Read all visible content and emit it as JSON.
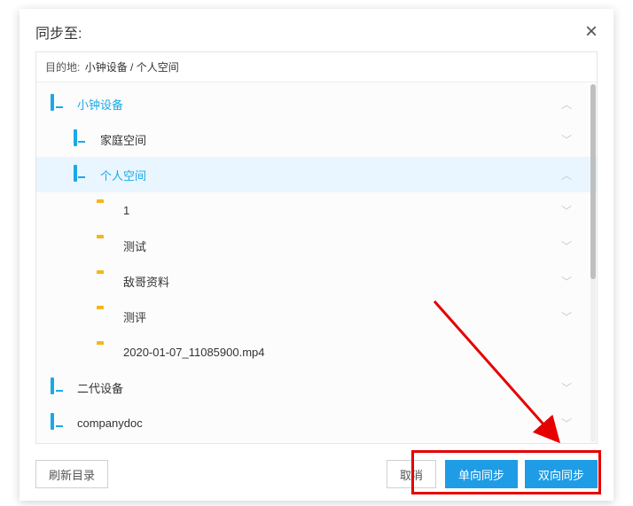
{
  "dialog": {
    "title": "同步至:",
    "close": "×",
    "dest_label": "目的地:",
    "dest_path": "小钟设备 / 个人空间"
  },
  "tree": [
    {
      "id": "dev-xiaozhong",
      "depth": 0,
      "icon": "device",
      "label": "小钟设备",
      "expand": "up",
      "accent": true,
      "selected": false
    },
    {
      "id": "space-family",
      "depth": 1,
      "icon": "device-sub",
      "label": "家庭空间",
      "expand": "down",
      "accent": false,
      "selected": false
    },
    {
      "id": "space-personal",
      "depth": 1,
      "icon": "device-sub",
      "label": "个人空间",
      "expand": "up",
      "accent": true,
      "selected": true
    },
    {
      "id": "folder-1",
      "depth": 2,
      "icon": "folder",
      "label": "1",
      "expand": "down",
      "accent": false,
      "selected": false
    },
    {
      "id": "folder-test",
      "depth": 2,
      "icon": "folder",
      "label": "测试",
      "expand": "down",
      "accent": false,
      "selected": false
    },
    {
      "id": "folder-dige",
      "depth": 2,
      "icon": "folder",
      "label": "敌哥资料",
      "expand": "down",
      "accent": false,
      "selected": false
    },
    {
      "id": "folder-ceping",
      "depth": 2,
      "icon": "folder",
      "label": "测评",
      "expand": "down",
      "accent": false,
      "selected": false
    },
    {
      "id": "file-mp4",
      "depth": 2,
      "icon": "folder",
      "label": "2020-01-07_11085900.mp4",
      "expand": "",
      "accent": false,
      "selected": false
    },
    {
      "id": "dev-erdai",
      "depth": 0,
      "icon": "device",
      "label": "二代设备",
      "expand": "down",
      "accent": false,
      "selected": false
    },
    {
      "id": "dev-company",
      "depth": 0,
      "icon": "device",
      "label": "companydoc",
      "expand": "down",
      "accent": false,
      "selected": false
    }
  ],
  "chevrons": {
    "up": "︿",
    "down": "﹀",
    "": ""
  },
  "footer": {
    "refresh": "刷新目录",
    "cancel": "取消",
    "oneway": "单向同步",
    "twoway": "双向同步"
  }
}
